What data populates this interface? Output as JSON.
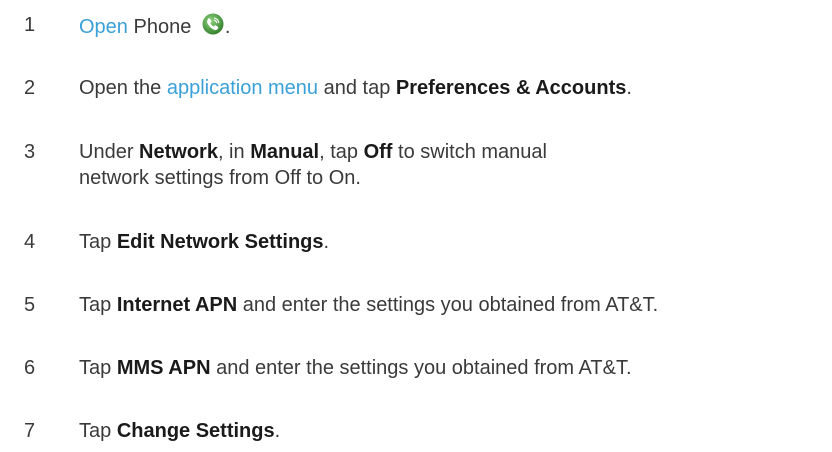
{
  "steps": [
    {
      "number": "1",
      "segments": [
        {
          "text": "Open",
          "style": "link"
        },
        {
          "text": " Phone ",
          "style": "plain"
        }
      ],
      "icon": "phone-icon",
      "tail": "."
    },
    {
      "number": "2",
      "segments": [
        {
          "text": "Open the ",
          "style": "plain"
        },
        {
          "text": "application menu",
          "style": "link"
        },
        {
          "text": " and tap ",
          "style": "plain"
        },
        {
          "text": "Preferences & Accounts",
          "style": "bold"
        },
        {
          "text": ".",
          "style": "plain"
        }
      ]
    },
    {
      "number": "3",
      "segments": [
        {
          "text": "Under ",
          "style": "plain"
        },
        {
          "text": "Network",
          "style": "bold"
        },
        {
          "text": ", in ",
          "style": "plain"
        },
        {
          "text": "Manual",
          "style": "bold"
        },
        {
          "text": ", tap ",
          "style": "plain"
        },
        {
          "text": "Off",
          "style": "bold"
        },
        {
          "text": " to switch manual network settings from Off to On.",
          "style": "plain"
        }
      ]
    },
    {
      "number": "4",
      "segments": [
        {
          "text": "Tap ",
          "style": "plain"
        },
        {
          "text": "Edit Network Settings",
          "style": "bold"
        },
        {
          "text": ".",
          "style": "plain"
        }
      ]
    },
    {
      "number": "5",
      "segments": [
        {
          "text": "Tap ",
          "style": "plain"
        },
        {
          "text": "Internet APN",
          "style": "bold"
        },
        {
          "text": " and enter the settings you obtained from AT&T.",
          "style": "plain"
        }
      ]
    },
    {
      "number": "6",
      "segments": [
        {
          "text": "Tap ",
          "style": "plain"
        },
        {
          "text": "MMS APN",
          "style": "bold"
        },
        {
          "text": " and enter the settings you obtained from AT&T.",
          "style": "plain"
        }
      ]
    },
    {
      "number": "7",
      "segments": [
        {
          "text": "Tap ",
          "style": "plain"
        },
        {
          "text": "Change Settings",
          "style": "bold"
        },
        {
          "text": ".",
          "style": "plain"
        }
      ]
    }
  ],
  "colors": {
    "link": "#3aa0d8",
    "text": "#3a3a3a",
    "bold": "#1a1a1a",
    "icon_green": "#3f9b3a"
  }
}
